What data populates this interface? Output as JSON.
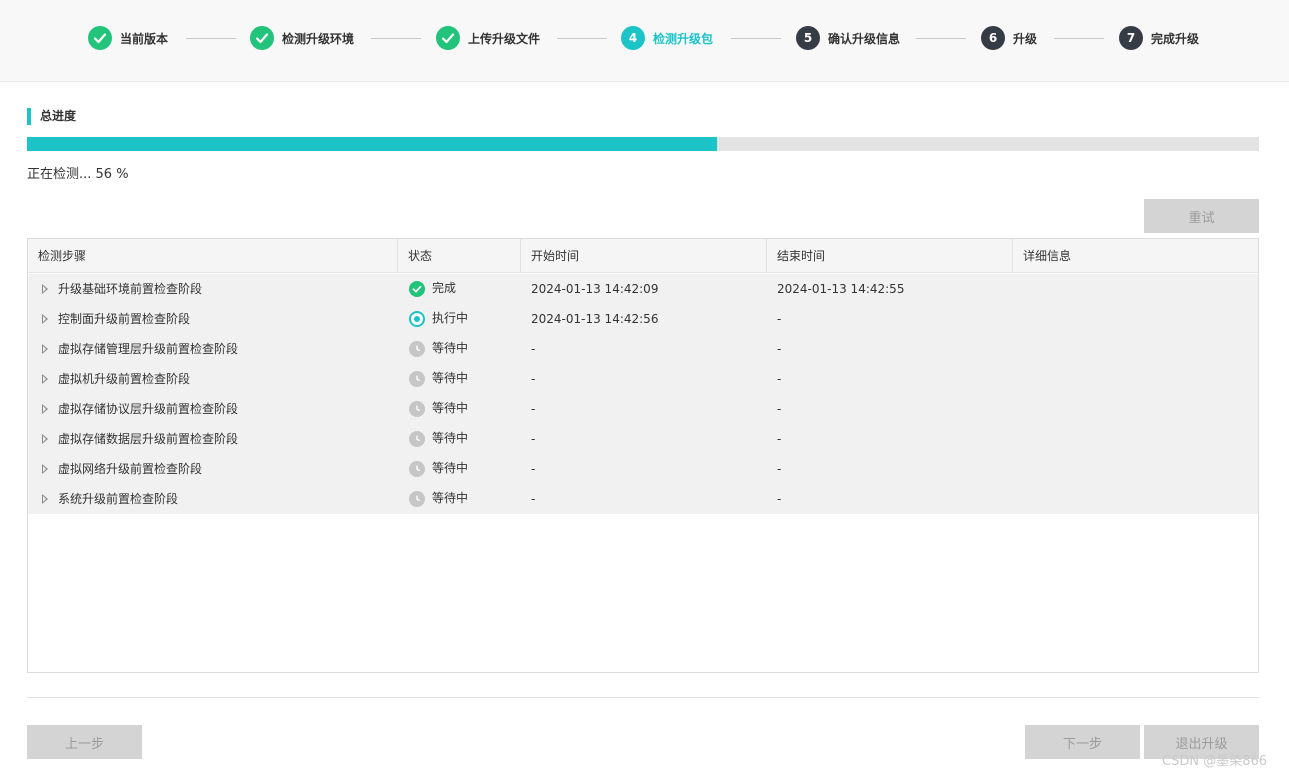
{
  "stepper": {
    "steps": [
      {
        "number": "1",
        "label": "当前版本",
        "state": "done"
      },
      {
        "number": "2",
        "label": "检测升级环境",
        "state": "done"
      },
      {
        "number": "3",
        "label": "上传升级文件",
        "state": "done"
      },
      {
        "number": "4",
        "label": "检测升级包",
        "state": "active"
      },
      {
        "number": "5",
        "label": "确认升级信息",
        "state": "pending"
      },
      {
        "number": "6",
        "label": "升级",
        "state": "pending"
      },
      {
        "number": "7",
        "label": "完成升级",
        "state": "pending"
      }
    ]
  },
  "progress": {
    "section_title": "总进度",
    "percent": 56,
    "status_text": "正在检测... 56 %"
  },
  "buttons": {
    "retry": "重试",
    "prev": "上一步",
    "next": "下一步",
    "exit": "退出升级"
  },
  "table": {
    "columns": [
      "检测步骤",
      "状态",
      "开始时间",
      "结束时间",
      "详细信息"
    ],
    "rows": [
      {
        "step": "升级基础环境前置检查阶段",
        "status": "完成",
        "status_type": "done",
        "start": "2024-01-13 14:42:09",
        "end": "2024-01-13 14:42:55",
        "detail": ""
      },
      {
        "step": "控制面升级前置检查阶段",
        "status": "执行中",
        "status_type": "running",
        "start": "2024-01-13 14:42:56",
        "end": "-",
        "detail": ""
      },
      {
        "step": "虚拟存储管理层升级前置检查阶段",
        "status": "等待中",
        "status_type": "waiting",
        "start": "-",
        "end": "-",
        "detail": ""
      },
      {
        "step": "虚拟机升级前置检查阶段",
        "status": "等待中",
        "status_type": "waiting",
        "start": "-",
        "end": "-",
        "detail": ""
      },
      {
        "step": "虚拟存储协议层升级前置检查阶段",
        "status": "等待中",
        "status_type": "waiting",
        "start": "-",
        "end": "-",
        "detail": ""
      },
      {
        "step": "虚拟存储数据层升级前置检查阶段",
        "status": "等待中",
        "status_type": "waiting",
        "start": "-",
        "end": "-",
        "detail": ""
      },
      {
        "step": "虚拟网络升级前置检查阶段",
        "status": "等待中",
        "status_type": "waiting",
        "start": "-",
        "end": "-",
        "detail": ""
      },
      {
        "step": "系统升级前置检查阶段",
        "status": "等待中",
        "status_type": "waiting",
        "start": "-",
        "end": "-",
        "detail": ""
      }
    ]
  },
  "watermark": "CSDN @墨染866",
  "colors": {
    "accent": "#1cc4c8",
    "done": "#22c37a",
    "pending": "#363c45",
    "disabled": "#d4d4d4"
  }
}
